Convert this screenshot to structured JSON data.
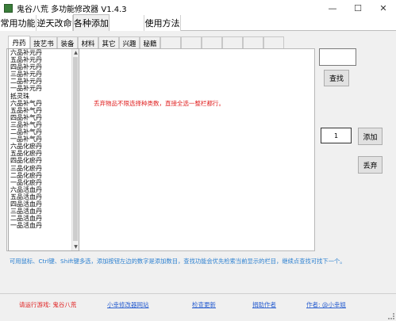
{
  "window": {
    "title": "鬼谷八荒 多功能修改器  V1.4.3",
    "min_glyph": "—",
    "max_glyph": "☐",
    "close_glyph": "✕"
  },
  "main_tabs": [
    "常用功能",
    "逆天改命",
    "各种添加",
    "",
    "使用方法"
  ],
  "sub_tabs": [
    "丹药",
    "技艺书",
    "装备",
    "材料",
    "其它",
    "兴趣",
    "秘籍",
    "",
    "",
    "",
    "",
    "",
    ""
  ],
  "item_list": [
    "六品补元丹",
    "五品补元丹",
    "四品补元丹",
    "三品补元丹",
    "二品补元丹",
    "一品补元丹",
    "抵灵珠",
    "六品补气丹",
    "五品补气丹",
    "四品补气丹",
    "三品补气丹",
    "二品补气丹",
    "一品补气丹",
    "六品化瘀丹",
    "五品化瘀丹",
    "四品化瘀丹",
    "三品化瘀丹",
    "二品化瘀丹",
    "一品化瘀丹",
    "六品活血丹",
    "五品活血丹",
    "四品活血丹",
    "三品活血丹",
    "二品活血丹",
    "一品活血丹"
  ],
  "notice": "丢弃物品不限选择种类数，直接全选一整栏都行。",
  "search": {
    "value": "",
    "button": "查找"
  },
  "add": {
    "quantity": "1",
    "button": "添加"
  },
  "discard_button": "丢弃",
  "hint": "可用鼠标、Ctrl键、Shift键多选，添加按钮左边的数字是添加数目，查找功能会优先检索当前显示的栏目，继续点查找可找下一个。",
  "footer": {
    "game_label": "请运行游戏:   鬼谷八荒",
    "site_link": "小幸修改器网站",
    "update_link": "检查更新",
    "donate_link": "捐助作者",
    "author": "作者: @小幸姐"
  }
}
